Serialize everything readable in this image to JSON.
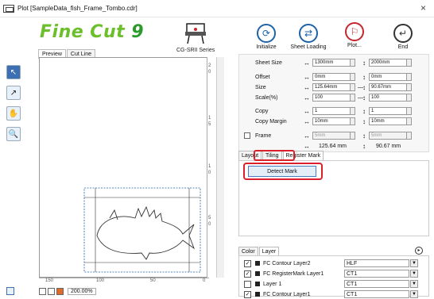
{
  "window": {
    "title": "Plot [SampleData_fish_Frame_Tombo.cdr]",
    "close_symbol": "×"
  },
  "logo": {
    "text_a": "Fine Cut ",
    "text_b": "9"
  },
  "device": {
    "label": "CG-SRII Series"
  },
  "left_tabs": [
    "Preview",
    "Cut Line"
  ],
  "tools": [
    {
      "name": "select-arrow-icon",
      "glyph": "↖",
      "selected": true
    },
    {
      "name": "move-arrow-icon",
      "glyph": "↗",
      "selected": false
    },
    {
      "name": "hand-icon",
      "glyph": "✋",
      "selected": false
    },
    {
      "name": "zoom-icon",
      "glyph": "🔍",
      "selected": false
    }
  ],
  "ruler_v": [
    "2",
    "0",
    "1",
    "5",
    "1",
    "0",
    "5",
    "0"
  ],
  "ruler_h": [
    "150",
    "100",
    "50",
    "0"
  ],
  "zoom": {
    "value": "200.00%"
  },
  "actions": [
    {
      "id": "initialize",
      "label": "Initialize",
      "icon": "refresh-icon",
      "glyph": "⟳"
    },
    {
      "id": "sheet-loading",
      "label": "Sheet Loading",
      "icon": "swap-icon",
      "glyph": "⇄"
    },
    {
      "id": "plot",
      "label": "Plot...",
      "icon": "plot-icon",
      "glyph": "⚐"
    },
    {
      "id": "end",
      "label": "End",
      "icon": "return-icon",
      "glyph": "↵"
    }
  ],
  "params": {
    "sheet_size": {
      "label": "Sheet Size",
      "w": "1300mm",
      "h": "2000mm"
    },
    "offset": {
      "label": "Offset",
      "x": "0mm",
      "y": "0mm"
    },
    "size": {
      "label": "Size",
      "w": "125.64mm",
      "h": "90.67mm"
    },
    "scale": {
      "label": "Scale(%)",
      "w": "100",
      "h": "100"
    },
    "copy": {
      "label": "Copy",
      "x": "1",
      "y": "1"
    },
    "copy_margin": {
      "label": "Copy Margin",
      "x": "10mm",
      "y": "10mm"
    },
    "frame": {
      "label": "Frame",
      "x": "5mm",
      "y": "5mm",
      "w_text": "125.64 mm",
      "h_text": "90.67 mm"
    }
  },
  "right_tabs": [
    "Layout",
    "Tiling",
    "Register Mark"
  ],
  "detect": {
    "label": "Detect Mark"
  },
  "layer_tabs": [
    "Color",
    "Layer"
  ],
  "layers": [
    {
      "checked": true,
      "name": "FC Contour Layer2",
      "type": "HLF"
    },
    {
      "checked": true,
      "name": "FC RegisterMark Layer1",
      "type": "CT1"
    },
    {
      "checked": false,
      "name": "Layer 1",
      "type": "CT1"
    },
    {
      "checked": true,
      "name": "FC Contour Layer1",
      "type": "CT1"
    }
  ],
  "colors": {
    "accent": "#1e62a8",
    "plot_red": "#c3262e",
    "highlight_red": "#d9212b",
    "logo_green": "#6bbf2a"
  }
}
